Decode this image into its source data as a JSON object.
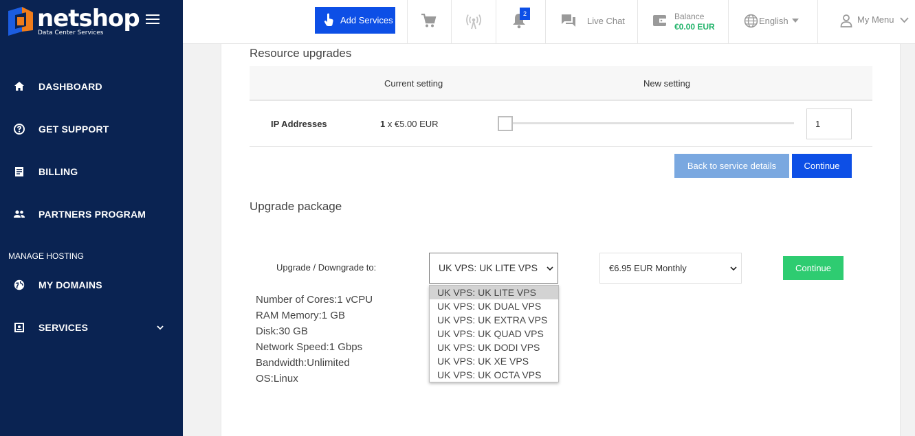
{
  "brand": {
    "name": "netshop",
    "tagline": "Data Center Services"
  },
  "sidebar": {
    "items": [
      {
        "label": "DASHBOARD",
        "icon": "home-icon"
      },
      {
        "label": "GET SUPPORT",
        "icon": "help-circle-icon"
      },
      {
        "label": "BILLING",
        "icon": "billing-icon"
      },
      {
        "label": "PARTNERS PROGRAM",
        "icon": "people-icon"
      }
    ],
    "section_label": "MANAGE HOSTING",
    "hosting_items": [
      {
        "label": "MY DOMAINS",
        "icon": "globe-icon"
      },
      {
        "label": "SERVICES",
        "icon": "services-icon"
      }
    ]
  },
  "topbar": {
    "add_services": "Add Services",
    "notifications_count": "2",
    "live_chat": "Live Chat",
    "balance_title": "Balance",
    "balance_value": "€0.00 EUR",
    "language": "English",
    "my_menu": "My Menu"
  },
  "resource_upgrades": {
    "title": "Resource upgrades",
    "col_current": "Current setting",
    "col_new": "New setting",
    "row": {
      "label": "IP Addresses",
      "current_qty": "1",
      "current_price": " x €5.00 EUR",
      "slider_fraction": 0,
      "new_value": "1"
    },
    "back_button": "Back to service details",
    "continue_button": "Continue"
  },
  "upgrade_package": {
    "title": "Upgrade package",
    "label": "Upgrade / Downgrade to:",
    "selected_package": "UK VPS: UK LITE VPS",
    "selected_price": "€6.95 EUR Monthly",
    "continue_button": "Continue",
    "options": [
      "UK VPS: UK LITE VPS",
      "UK VPS: UK DUAL VPS",
      "UK VPS: UK EXTRA VPS",
      "UK VPS: UK QUAD VPS",
      "UK VPS: UK DODI VPS",
      "UK VPS: UK XE VPS",
      "UK VPS: UK OCTA VPS"
    ],
    "specs": [
      "Number of Cores:1 vCPU",
      "RAM Memory:1 GB",
      "Disk:30 GB",
      "Network Speed:1 Gbps",
      "Bandwidth:Unlimited",
      "OS:Linux"
    ]
  },
  "colors": {
    "sidebar_bg": "#0a2352",
    "primary": "#0d4fe6",
    "success": "#2ecc71",
    "balance_green": "#21b36a"
  }
}
